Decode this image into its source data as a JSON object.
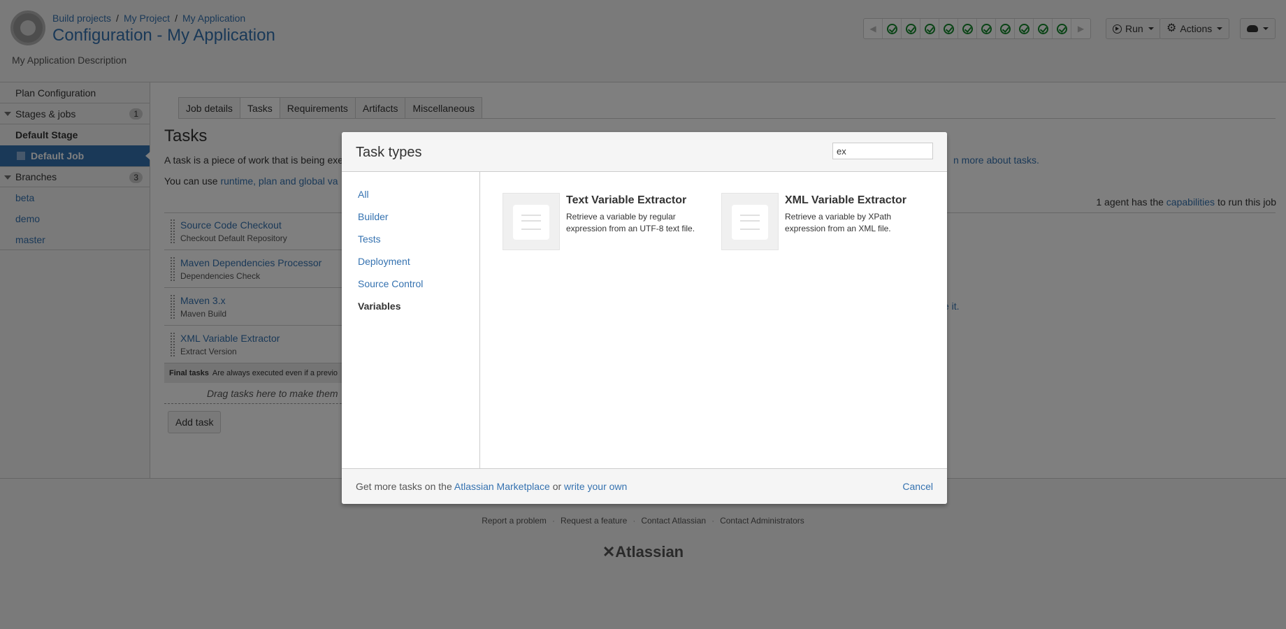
{
  "header": {
    "breadcrumbs": [
      "Build projects",
      "My Project",
      "My Application"
    ],
    "breadcrumb_sep": "/",
    "title": "Configuration - My Application",
    "description": "My Application Description",
    "build_strip": {
      "status_count": 10,
      "status": "successful",
      "status_color": "#14892c"
    },
    "run_label": "Run",
    "actions_label": "Actions"
  },
  "sidebar": {
    "plan_config": "Plan Configuration",
    "stages_label": "Stages & jobs",
    "stages_count": "1",
    "stage": "Default Stage",
    "job": "Default Job",
    "branches_label": "Branches",
    "branches_count": "3",
    "branches": [
      "beta",
      "demo",
      "master"
    ]
  },
  "main": {
    "tabs": [
      "Job details",
      "Tasks",
      "Requirements",
      "Artifacts",
      "Miscellaneous"
    ],
    "active_tab": "Tasks",
    "title": "Tasks",
    "intro1": "A task is a piece of work that is being exe",
    "learn_more": "n more about tasks.",
    "intro2_prefix": "You can use ",
    "intro2_link": "runtime, plan and global va",
    "agent_prefix": "1 agent has the ",
    "agent_link": "capabilities",
    "agent_suffix": " to run this job",
    "right_note": "e it.",
    "tasks": [
      {
        "name": "Source Code Checkout",
        "desc": "Checkout Default Repository"
      },
      {
        "name": "Maven Dependencies Processor",
        "desc": "Dependencies Check"
      },
      {
        "name": "Maven 3.x",
        "desc": "Maven Build"
      },
      {
        "name": "XML Variable Extractor",
        "desc": "Extract Version"
      }
    ],
    "final_tasks_label": "Final tasks",
    "final_tasks_note": "Are always executed even if a previo",
    "drag_hint": "Drag tasks here to make them",
    "add_task": "Add task"
  },
  "footer": {
    "links": [
      "Report a problem",
      "Request a feature",
      "Contact Atlassian",
      "Contact Administrators"
    ],
    "logo_text": "Atlassian"
  },
  "dialog": {
    "title": "Task types",
    "search_value": "ex",
    "categories": [
      "All",
      "Builder",
      "Tests",
      "Deployment",
      "Source Control",
      "Variables"
    ],
    "active_category": "Variables",
    "task_types": [
      {
        "name": "Text Variable Extractor",
        "desc": "Retrieve a variable by regular expression from an UTF-8 text file."
      },
      {
        "name": "XML Variable Extractor",
        "desc": "Retrieve a variable by XPath expression from an XML file."
      }
    ],
    "footer_prefix": "Get more tasks on the ",
    "marketplace_link": "Atlassian Marketplace",
    "footer_or": " or ",
    "write_own_link": "write your own",
    "cancel": "Cancel"
  }
}
